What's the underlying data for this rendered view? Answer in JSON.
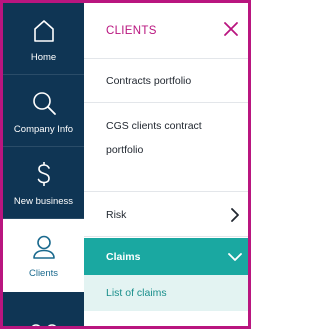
{
  "rail": {
    "items": [
      {
        "label": "Home",
        "icon": "home-icon"
      },
      {
        "label": "Company Info",
        "icon": "search-icon"
      },
      {
        "label": "New business",
        "icon": "dollar-icon"
      },
      {
        "label": "Clients",
        "icon": "user-icon",
        "active": true
      }
    ]
  },
  "panel": {
    "title": "CLIENTS",
    "close_icon": "close-icon",
    "items": [
      {
        "label": "Contracts portfolio"
      },
      {
        "label": "CGS clients contract portfolio"
      },
      {
        "label": "Risk",
        "chevron": "chevron-right-icon"
      },
      {
        "label": "Claims",
        "chevron": "chevron-down-icon",
        "expanded": true
      }
    ],
    "sub_items": [
      {
        "label": "List of claims"
      }
    ]
  },
  "colors": {
    "rail_bg": "#0f3554",
    "accent": "#b9157f",
    "teal": "#1aa8a1",
    "teal_light": "#e3f3f2"
  }
}
